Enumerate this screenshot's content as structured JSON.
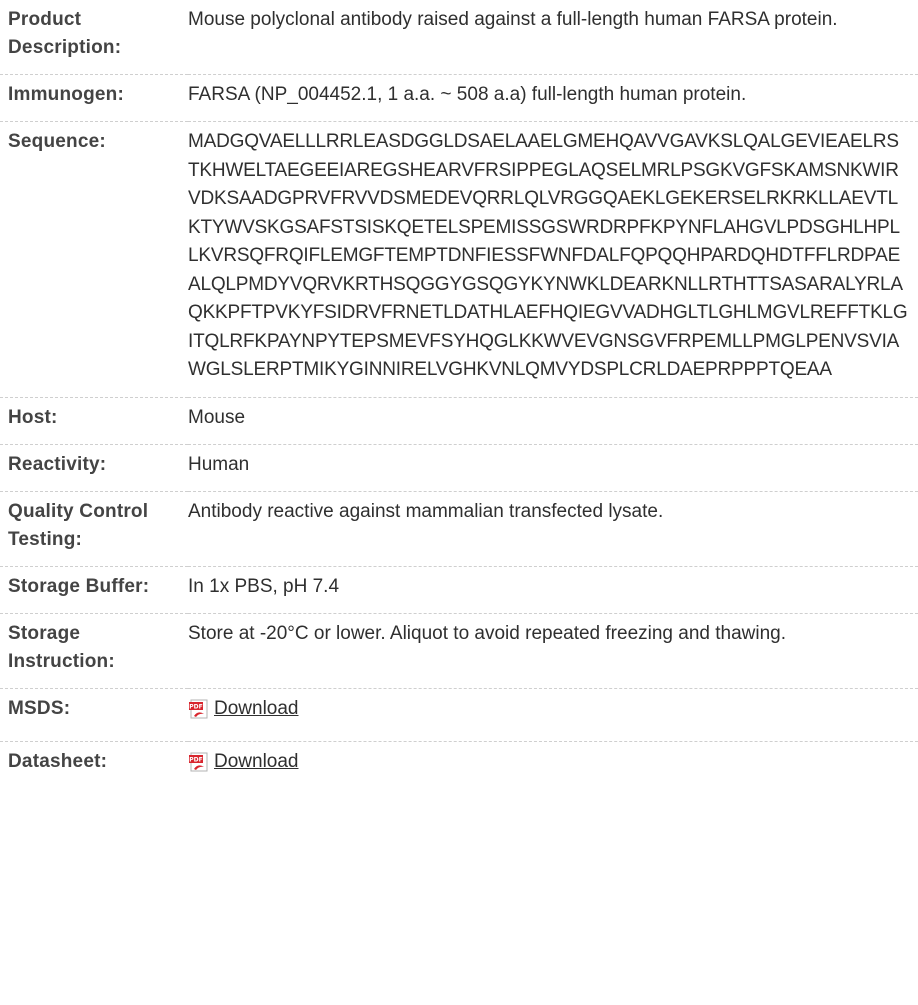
{
  "rows": {
    "product_description": {
      "label": "Product Description:",
      "value": "Mouse polyclonal antibody raised against a full-length human FARSA protein."
    },
    "immunogen": {
      "label": "Immunogen:",
      "value": "FARSA (NP_004452.1, 1 a.a. ~ 508 a.a) full-length human protein."
    },
    "sequence": {
      "label": "Sequence:",
      "value": "MADGQVAELLLRRLEASDGGLDSAELAAELGMEHQAVVGAVKSLQALGEVIEAELRSTKHWELTAEGEEIAREGSHEARVFRSIPPEGLAQSELMRLPSGKVGFSKAMSNKWIRVDKSAADGPRVFRVVDSMEDEVQRRLQLVRGGQAEKLGEKERSELRKRKLLAEVTLKTYWVSKGSAFSTSISKQETELSPEMISSGSWRDRPFKPYNFLAHGVLPDSGHLHPLLKVRSQFRQIFLEMGFTEMPTDNFIESSFWNFDALFQPQQHPARDQHDTFFLRDPAEALQLPMDYVQRVKRTHSQGGYGSQGYKYNWKLDEARKNLLRTHTTSASARALYRLAQKKPFTPVKYFSIDRVFRNETLDATHLAEFHQIEGVVADHGLTLGHLMGVLREFFTKLGITQLRFKPAYNPYTEPSMEVFSYHQGLKKWVEVGNSGVFRPEMLLPMGLPENVSVIAWGLSLERPTMIKYGINNIRELVGHKVNLQMVYDSPLCRLDAEPRPPPTQEAA"
    },
    "host": {
      "label": "Host:",
      "value": "Mouse"
    },
    "reactivity": {
      "label": "Reactivity:",
      "value": "Human"
    },
    "quality_control": {
      "label": "Quality Control Testing:",
      "value": "Antibody reactive against mammalian transfected lysate."
    },
    "storage_buffer": {
      "label": "Storage Buffer:",
      "value": "In 1x PBS, pH 7.4"
    },
    "storage_instruction": {
      "label": "Storage Instruction:",
      "value": "Store at -20°C or lower. Aliquot to avoid repeated freezing and thawing."
    },
    "msds": {
      "label": "MSDS:",
      "link_text": "Download",
      "icon": "pdf-icon"
    },
    "datasheet": {
      "label": "Datasheet:",
      "link_text": "Download",
      "icon": "pdf-icon"
    }
  },
  "colors": {
    "text": "#2f2f2f",
    "label": "#444444",
    "divider": "#cfcfcf",
    "pdf_red": "#d8262e"
  }
}
